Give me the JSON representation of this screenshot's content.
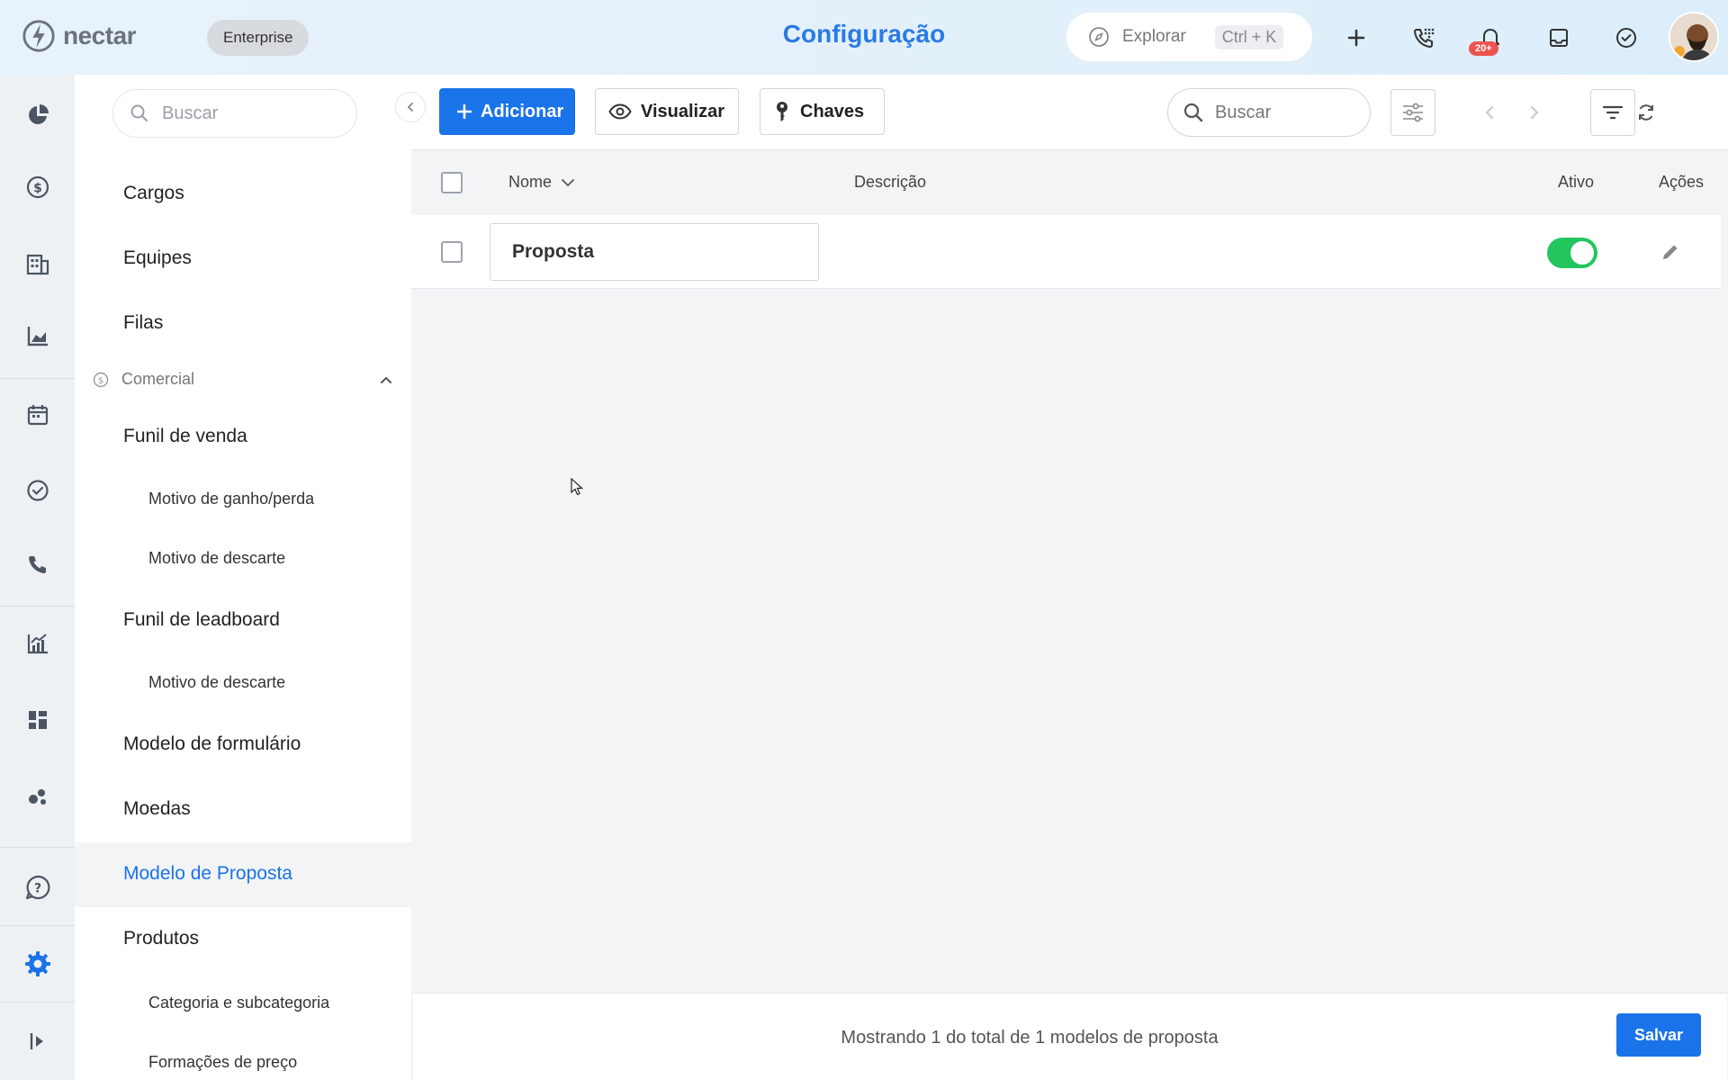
{
  "app": {
    "logo_text": "nectar",
    "plan_badge": "Enterprise",
    "page_title": "Configuração"
  },
  "topbar": {
    "explore_label": "Explorar",
    "explore_shortcut": "Ctrl + K",
    "notifications_count": "20+"
  },
  "sidebar": {
    "search_placeholder": "Buscar",
    "items": [
      {
        "label": "Cargos"
      },
      {
        "label": "Equipes"
      },
      {
        "label": "Filas"
      }
    ],
    "section": {
      "label": "Comercial"
    },
    "comercial_items": [
      {
        "label": "Funil de venda"
      },
      {
        "label": "Motivo de ganho/perda"
      },
      {
        "label": "Motivo de descarte"
      },
      {
        "label": "Funil de leadboard"
      },
      {
        "label": "Motivo de descarte"
      },
      {
        "label": "Modelo de formulário"
      },
      {
        "label": "Moedas"
      },
      {
        "label": "Modelo de Proposta"
      },
      {
        "label": "Produtos"
      },
      {
        "label": "Categoria e subcategoria"
      },
      {
        "label": "Formações de preço"
      }
    ]
  },
  "toolbar": {
    "add_label": "Adicionar",
    "view_label": "Visualizar",
    "keys_label": "Chaves",
    "search_placeholder": "Buscar"
  },
  "table": {
    "columns": {
      "name": "Nome",
      "description": "Descrição",
      "active": "Ativo",
      "actions": "Ações"
    },
    "rows": [
      {
        "name": "Proposta",
        "description": "",
        "active": true
      }
    ]
  },
  "footer": {
    "summary": "Mostrando 1 do total de 1 modelos de proposta",
    "save_label": "Salvar"
  },
  "colors": {
    "accent": "#1a73e8",
    "title": "#2a7ae4",
    "toggle_on": "#22c55e",
    "badge": "#ef5350"
  }
}
